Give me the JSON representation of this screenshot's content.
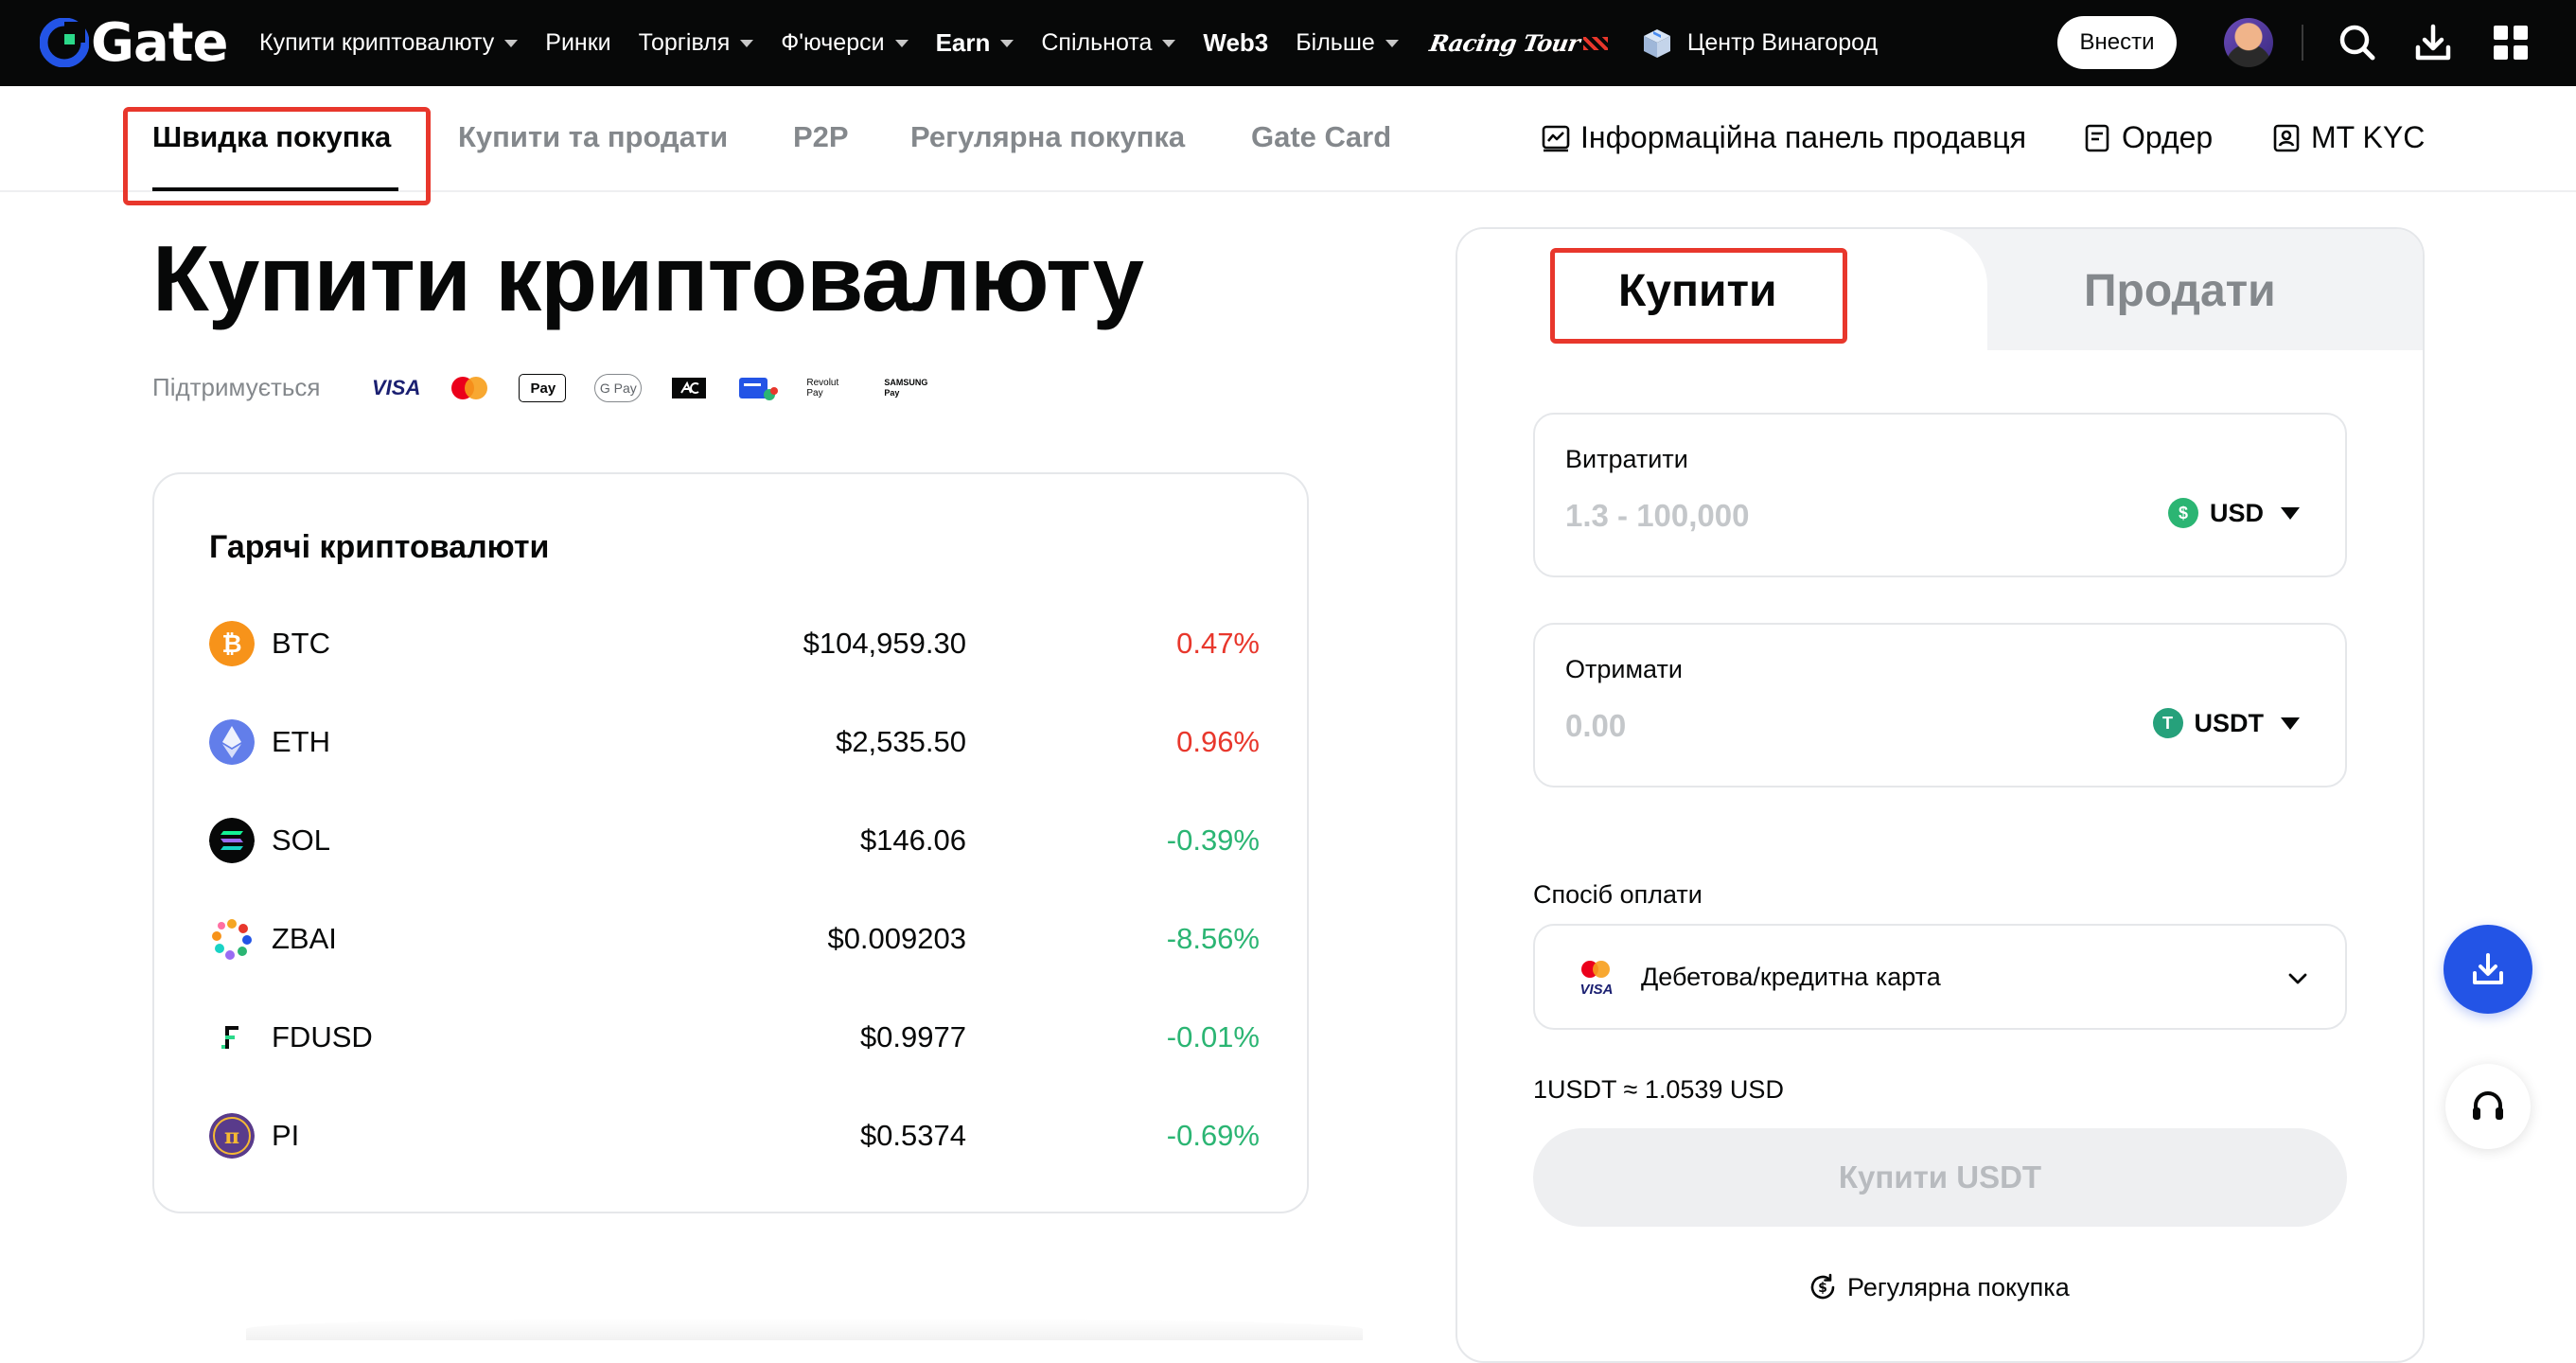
{
  "topnav": {
    "logo_text": "Gate",
    "items": [
      {
        "label": "Купити криптовалюту",
        "caret": true
      },
      {
        "label": "Ринки",
        "caret": false
      },
      {
        "label": "Торгівля",
        "caret": true
      },
      {
        "label": "Ф'ючерси",
        "caret": true
      },
      {
        "label": "Earn",
        "caret": true
      },
      {
        "label": "Спільнота",
        "caret": true
      },
      {
        "label": "Web3",
        "caret": false
      },
      {
        "label": "Більше",
        "caret": true
      }
    ],
    "racing_label": "Racing Tour",
    "center_label": "Центр Винагород",
    "deposit_label": "Внести",
    "icons": [
      "search-icon",
      "download-icon",
      "apps-grid-icon"
    ]
  },
  "subnav": {
    "tabs": [
      "Швидка покупка",
      "Купити та продати",
      "P2P",
      "Регулярна покупка",
      "Gate Card"
    ],
    "active_tab": "Швидка покупка",
    "right_links": [
      "Інформаційна панель продавця",
      "Ордер",
      "MT KYC"
    ]
  },
  "main": {
    "title": "Купити криптовалюту",
    "supported_label": "Підтримується",
    "payment_logos": [
      "VISA",
      "Mastercard",
      "Apple Pay",
      "G Pay",
      "ACH",
      "Bank transfer",
      "Revolut Pay",
      "Samsung Pay"
    ],
    "pay_logo_text": {
      "visa": "VISA",
      "applepay": "Pay",
      "gpay": "G Pay",
      "revolut": "Revolut Pay",
      "samsung_top": "SAMSUNG",
      "samsung_bottom": "Pay"
    }
  },
  "hot": {
    "title": "Гарячі криптовалюти",
    "rows": [
      {
        "symbol": "BTC",
        "price": "$104,959.30",
        "change": "0.47%",
        "direction": "up",
        "icon": "bitcoin-icon",
        "color": "#f7931a"
      },
      {
        "symbol": "ETH",
        "price": "$2,535.50",
        "change": "0.96%",
        "direction": "up",
        "icon": "ethereum-icon",
        "color": "#627eea"
      },
      {
        "symbol": "SOL",
        "price": "$146.06",
        "change": "-0.39%",
        "direction": "down",
        "icon": "solana-icon",
        "color": "#000000"
      },
      {
        "symbol": "ZBAI",
        "price": "$0.009203",
        "change": "-8.56%",
        "direction": "down",
        "icon": "zbai-icon",
        "color": "#f5a623"
      },
      {
        "symbol": "FDUSD",
        "price": "$0.9977",
        "change": "-0.01%",
        "direction": "down",
        "icon": "fdusd-icon",
        "color": "#0a0a0a"
      },
      {
        "symbol": "PI",
        "price": "$0.5374",
        "change": "-0.69%",
        "direction": "down",
        "icon": "pi-icon",
        "color": "#593b8b"
      }
    ]
  },
  "trade": {
    "tab_buy": "Купити",
    "tab_sell": "Продати",
    "spend_label": "Витратити",
    "spend_placeholder": "1.3 - 100,000",
    "spend_currency": "USD",
    "spend_currency_symbol": "$",
    "receive_label": "Отримати",
    "receive_placeholder": "0.00",
    "receive_currency": "USDT",
    "receive_currency_symbol": "T",
    "payment_method_label": "Спосіб оплати",
    "payment_method_value": "Дебетова/кредитна карта",
    "payment_card_visa_text": "VISA",
    "rate_text": "1USDT ≈ 1.0539 USD",
    "buy_button": "Купити USDT",
    "recurring_link": "Регулярна покупка"
  },
  "colors": {
    "brand_blue": "#2354e6",
    "up_red": "#e8372c",
    "down_green": "#2bb573",
    "nav_bg": "#070808"
  }
}
